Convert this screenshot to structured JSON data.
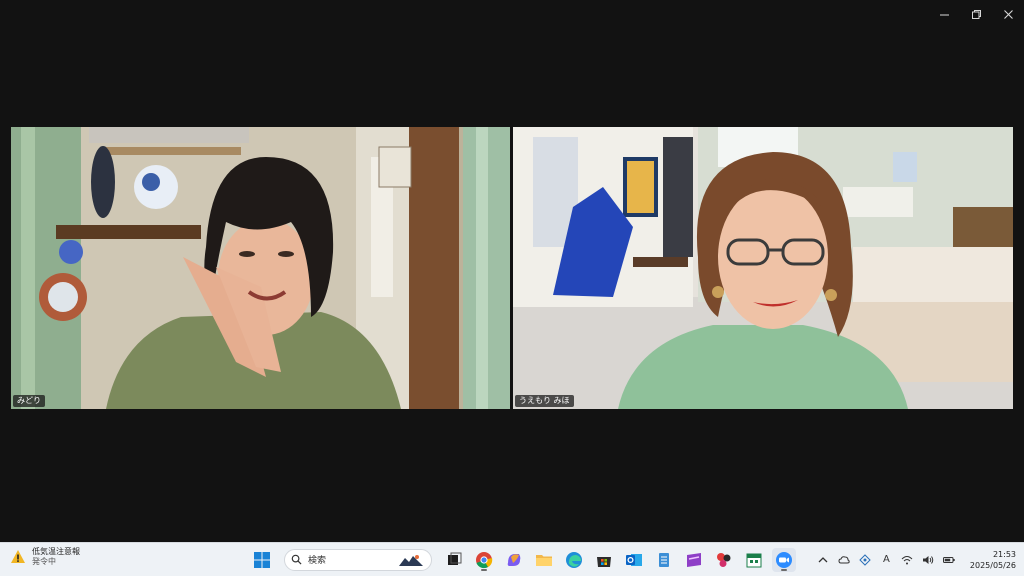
{
  "window": {
    "minimize_icon": "minimize-icon",
    "restore_icon": "restore-icon",
    "close_icon": "close-icon"
  },
  "participants": [
    {
      "name": "みどり"
    },
    {
      "name": "うえもり みほ"
    }
  ],
  "taskbar": {
    "weather": {
      "title": "低気温注意報",
      "subtitle": "発令中"
    },
    "search_placeholder": "検索",
    "apps": [
      "start",
      "search",
      "task-view",
      "chrome",
      "copilot",
      "file-explorer",
      "edge",
      "store",
      "outlook",
      "notepad",
      "app-purple",
      "app-red",
      "calendar",
      "zoom"
    ],
    "tray": {
      "ime": "A"
    },
    "clock": {
      "time": "21:53",
      "date": "2025/05/26"
    }
  }
}
